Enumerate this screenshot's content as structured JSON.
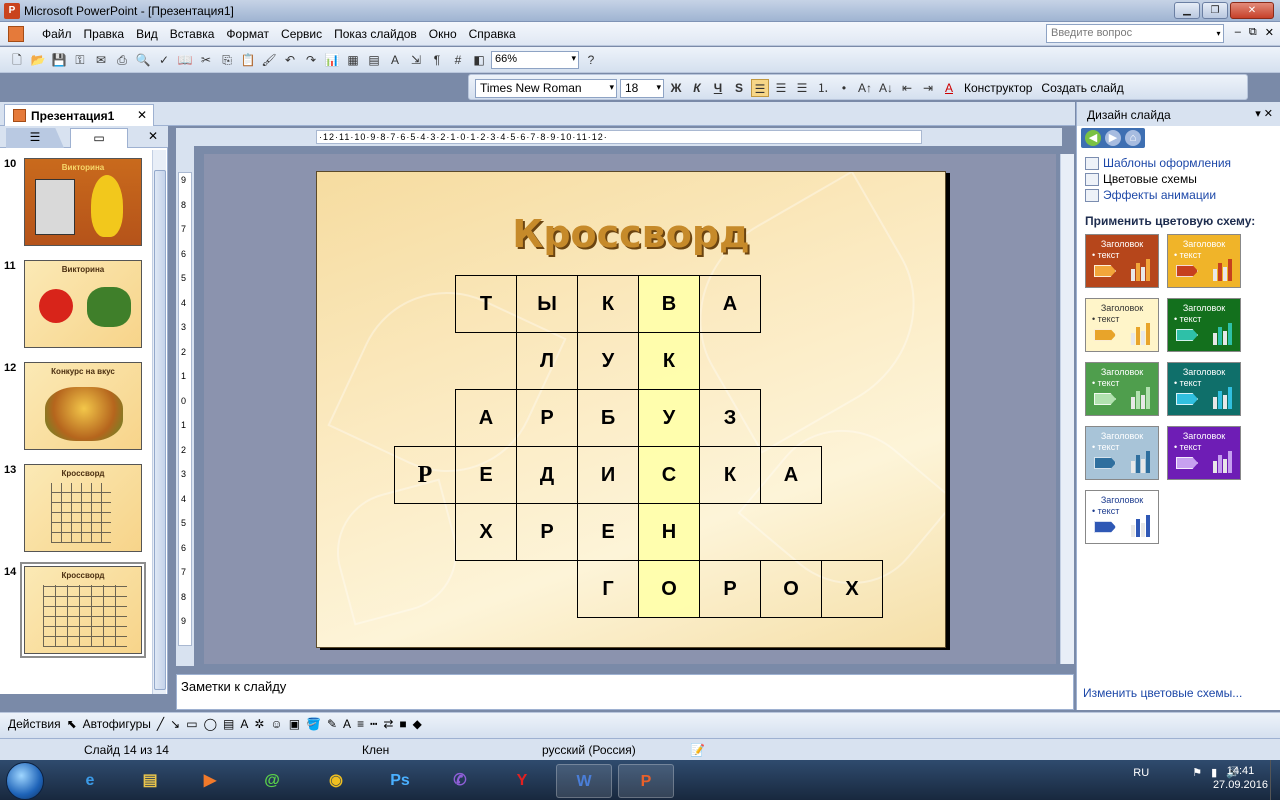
{
  "window": {
    "title": "Microsoft PowerPoint - [Презентация1]",
    "app_icon": "P"
  },
  "menu": {
    "items": [
      "Файл",
      "Правка",
      "Вид",
      "Вставка",
      "Формат",
      "Сервис",
      "Показ слайдов",
      "Окно",
      "Справка"
    ],
    "ask_placeholder": "Введите вопрос"
  },
  "toolbar": {
    "zoom": "66%",
    "font_name": "Times New Roman",
    "font_size": "18",
    "bold": "Ж",
    "italic": "К",
    "underline": "Ч",
    "shadow": "S",
    "designer": "Конструктор",
    "new_slide": "Создать слайд"
  },
  "document_tab": {
    "label": "Презентация1"
  },
  "thumbnails": [
    {
      "num": "10",
      "title": "Викторина"
    },
    {
      "num": "11",
      "title": "Викторина"
    },
    {
      "num": "12",
      "title": "Конкурс на вкус"
    },
    {
      "num": "13",
      "title": "Кроссворд"
    },
    {
      "num": "14",
      "title": "Кроссворд"
    }
  ],
  "ruler": {
    "horizontal": "·12·11·10·9·8·7·6·5·4·3·2·1·0·1·2·3·4·5·6·7·8·9·10·11·12·",
    "vertical": "9 8 7 6 5 4 3 2 1 0 1 2 3 4 5 6 7 8 9"
  },
  "slide": {
    "title": "Кроссворд",
    "rows": [
      [
        "Т",
        "Ы",
        "К",
        "В",
        "А"
      ],
      [
        "Л",
        "У",
        "К"
      ],
      [
        "А",
        "Р",
        "Б",
        "У",
        "З"
      ],
      [
        "Р",
        "Е",
        "Д",
        "И",
        "С",
        "К",
        "А"
      ],
      [
        "Х",
        "Р",
        "Е",
        "Н"
      ],
      [
        "Г",
        "О",
        "Р",
        "О",
        "Х"
      ]
    ]
  },
  "notes": {
    "placeholder": "Заметки к слайду"
  },
  "taskpane": {
    "title": "Дизайн слайда",
    "links": [
      "Шаблоны оформления",
      "Цветовые схемы",
      "Эффекты анимации"
    ],
    "apply_label": "Применить цветовую схему:",
    "scheme_heading": "Заголовок",
    "scheme_text": "• текст",
    "bottom_link": "Изменить цветовые схемы...",
    "schemes": [
      {
        "bg": "#b6461b",
        "fg": "#ffffff",
        "accent": "#f2a63a"
      },
      {
        "bg": "#f0b429",
        "fg": "#ffffff",
        "accent": "#c6401e"
      },
      {
        "bg": "#fff5c9",
        "fg": "#333333",
        "accent": "#e8a42a"
      },
      {
        "bg": "#13701d",
        "fg": "#ffffff",
        "accent": "#2ec0a8"
      },
      {
        "bg": "#4f9e4d",
        "fg": "#ffffff",
        "accent": "#b2e2b0"
      },
      {
        "bg": "#0f6f6a",
        "fg": "#ffffff",
        "accent": "#31c0e0"
      },
      {
        "bg": "#a8c4d8",
        "fg": "#ffffff",
        "accent": "#2f6f9e"
      },
      {
        "bg": "#6e1db5",
        "fg": "#ffffff",
        "accent": "#c7a0f0"
      },
      {
        "bg": "#ffffff",
        "fg": "#1d3c8f",
        "accent": "#2f58b5"
      }
    ]
  },
  "drawbar": {
    "actions": "Действия",
    "autoshapes": "Автофигуры"
  },
  "status": {
    "slide": "Слайд 14 из 14",
    "design": "Клен",
    "language": "русский (Россия)"
  },
  "taskbar": {
    "lang": "RU",
    "time": "14:41",
    "date": "27.09.2016"
  }
}
